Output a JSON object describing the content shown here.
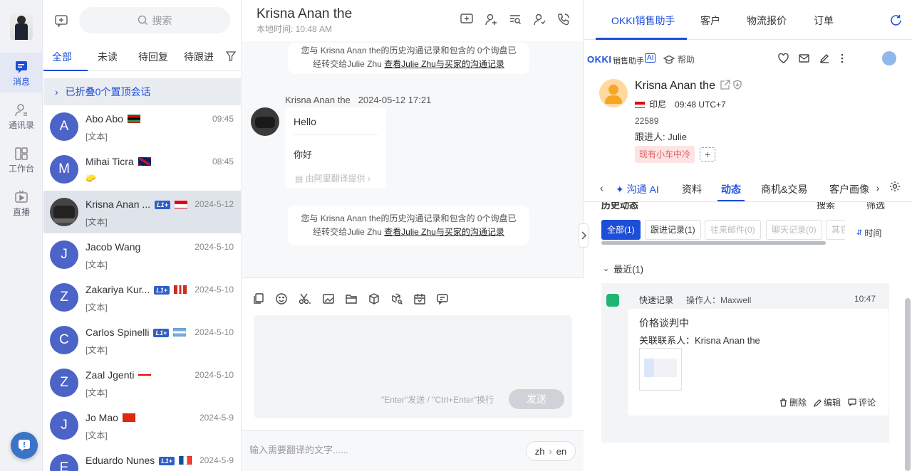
{
  "rail": {
    "items": [
      {
        "label": "消息",
        "icon": "message-icon"
      },
      {
        "label": "通讯录",
        "icon": "contacts-icon"
      },
      {
        "label": "工作台",
        "icon": "workbench-icon"
      },
      {
        "label": "直播",
        "icon": "live-icon"
      }
    ]
  },
  "conv_list": {
    "search_placeholder": "搜索",
    "tabs": [
      "全部",
      "未读",
      "待回复",
      "待跟进"
    ],
    "folded_text": "已折叠0个置顶会话",
    "items": [
      {
        "name": "Abo Abo",
        "sub": "[文本]",
        "time": "09:45",
        "initial": "A",
        "flag": "libya",
        "badge": ""
      },
      {
        "name": "Mihai Ticra",
        "sub": "🧽",
        "time": "08:45",
        "initial": "M",
        "flag": "uk",
        "badge": ""
      },
      {
        "name": "Krisna Anan ...",
        "sub": "[文本]",
        "time": "2024-5-12",
        "initial": "",
        "flag": "indonesia",
        "badge": "L1+"
      },
      {
        "name": "Jacob Wang",
        "sub": "[文本]",
        "time": "2024-5-10",
        "initial": "J",
        "flag": "",
        "badge": ""
      },
      {
        "name": "Zakariya Kur...",
        "sub": "[文本]",
        "time": "2024-5-10",
        "initial": "Z",
        "flag": "canada",
        "badge": "L1+"
      },
      {
        "name": "Carlos Spinelli",
        "sub": "[文本]",
        "time": "2024-5-10",
        "initial": "C",
        "flag": "argentina",
        "badge": "L1+"
      },
      {
        "name": "Zaal Jgenti",
        "sub": "[文本]",
        "time": "2024-5-10",
        "initial": "Z",
        "flag": "georgia",
        "badge": ""
      },
      {
        "name": "Jo Mao",
        "sub": "[文本]",
        "time": "2024-5-9",
        "initial": "J",
        "flag": "china",
        "badge": ""
      },
      {
        "name": "Eduardo Nunes",
        "sub": "",
        "time": "2024-5-9",
        "initial": "E",
        "flag": "france",
        "badge": "L1+"
      }
    ]
  },
  "chat": {
    "title": "Krisna Anan the",
    "local_time": "本地时间: 10:48 AM",
    "system_line1": "您与 Krisna Anan the的历史沟通记录和包含的 0个询盘已",
    "system_line2_prefix": "经转交给Julie Zhu ",
    "system_link": "查看Julie Zhu与买家的沟通记录",
    "sender": "Krisna Anan the",
    "sent_time": "2024-05-12 17:21",
    "message": "Hello",
    "translation": "你好",
    "translation_source": "由阿里翻译提供",
    "input_hint": "\"Enter\"发送 / \"Ctrl+Enter\"换行",
    "send_label": "发送",
    "translate_placeholder": "输入需要翻译的文字......",
    "lang_from": "zh",
    "lang_to": "en"
  },
  "right": {
    "tabs": [
      "OKKI销售助手",
      "客户",
      "物流报价",
      "订单"
    ],
    "brand_logo": "OKKI",
    "brand_text": "销售助手",
    "ai_tag": "AI",
    "help": "帮助",
    "customer_name": "Krisna  Anan the",
    "country": "印尼",
    "local_time": "09:48 UTC+7",
    "customer_id": "22589",
    "follower": "跟进人: Julie",
    "tag": "现有小车中冷",
    "detail_tabs": [
      "沟通 AI",
      "资料",
      "动态",
      "商机&交易",
      "客户画像"
    ],
    "ghost_left": "历史动态",
    "ghost_mid": "搜索",
    "ghost_right": "筛选",
    "filters": [
      "全部(1)",
      "跟进记录(1)",
      "往来邮件(0)",
      "聊天记录(0)",
      "其它"
    ],
    "sort_label": "时间",
    "recent_label": "最近(1)",
    "record": {
      "title": "快速记录",
      "operator": "操作人：Maxwell",
      "time": "10:47",
      "content": "价格谈判中",
      "contact": "关联联系人：Krisna Anan the",
      "actions": [
        "删除",
        "编辑",
        "评论"
      ]
    }
  },
  "colors": {
    "accent": "#1d4ed8",
    "avatar": "#4c63c8",
    "tag_bg": "#fde3e3",
    "tag_text": "#e05b5b"
  }
}
